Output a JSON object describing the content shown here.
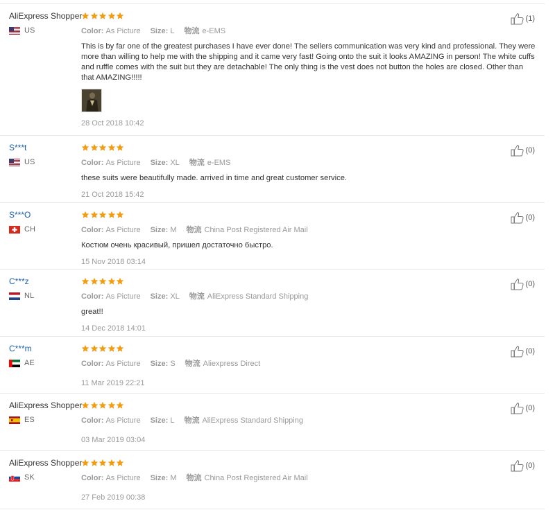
{
  "labels": {
    "color": "Color:",
    "size": "Size:",
    "shipping": "物流"
  },
  "reviews": [
    {
      "user": "AliExpress Shopper",
      "masked": false,
      "country": "US",
      "color": "As Picture",
      "size": "L",
      "shipping": "e-EMS",
      "text": "This is by far one of the greatest purchases I have ever done! The sellers communication was very kind and professional. They were more than willing to help me with the shipping and it came very fast! Going onto the suit it looks AMAZING in person! The white cuffs and ruffle comes with the suit but they are detachable! The only thing is the vest does not button the holes are closed. Other than that AMAZING!!!!!",
      "has_photo": true,
      "date": "28 Oct 2018 10:42",
      "helpful": "(1)",
      "rating": 5
    },
    {
      "user": "S***t",
      "masked": true,
      "country": "US",
      "color": "As Picture",
      "size": "XL",
      "shipping": "e-EMS",
      "text": "these suits were beautifully made. arrived in time and great customer service.",
      "has_photo": false,
      "date": "21 Oct 2018 15:42",
      "helpful": "(0)",
      "rating": 5
    },
    {
      "user": "S***O",
      "masked": true,
      "country": "CH",
      "color": "As Picture",
      "size": "M",
      "shipping": "China Post Registered Air Mail",
      "text": "Костюм очень красивый, пришел достаточно быстро.",
      "has_photo": false,
      "date": "15 Nov 2018 03:14",
      "helpful": "(0)",
      "rating": 5
    },
    {
      "user": "C***z",
      "masked": true,
      "country": "NL",
      "color": "As Picture",
      "size": "XL",
      "shipping": "AliExpress Standard Shipping",
      "text": "great!!",
      "has_photo": false,
      "date": "14 Dec 2018 14:01",
      "helpful": "(0)",
      "rating": 5
    },
    {
      "user": "C***m",
      "masked": true,
      "country": "AE",
      "color": "As Picture",
      "size": "S",
      "shipping": "Aliexpress Direct",
      "text": "",
      "has_photo": false,
      "date": "11 Mar 2019 22:21",
      "helpful": "(0)",
      "rating": 5
    },
    {
      "user": "AliExpress Shopper",
      "masked": false,
      "country": "ES",
      "color": "As Picture",
      "size": "L",
      "shipping": "AliExpress Standard Shipping",
      "text": "",
      "has_photo": false,
      "date": "03 Mar 2019 03:04",
      "helpful": "(0)",
      "rating": 5
    },
    {
      "user": "AliExpress Shopper",
      "masked": false,
      "country": "SK",
      "color": "As Picture",
      "size": "M",
      "shipping": "China Post Registered Air Mail",
      "text": "",
      "has_photo": false,
      "date": "27 Feb 2019 00:38",
      "helpful": "(0)",
      "rating": 5
    }
  ],
  "colors": {
    "star": "#f39c12",
    "masked_name": "#1a5fa8",
    "muted": "#999999"
  }
}
